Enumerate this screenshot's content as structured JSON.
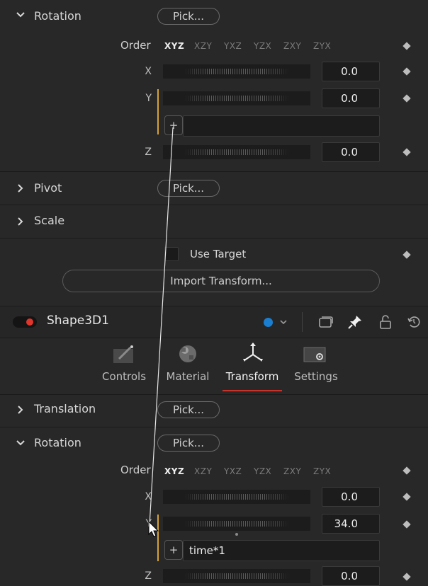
{
  "top_panel": {
    "rotation": {
      "title": "Rotation",
      "pick_label": "Pick...",
      "order_label": "Order",
      "order_options": [
        "XYZ",
        "XZY",
        "YXZ",
        "YZX",
        "ZXY",
        "ZYX"
      ],
      "selected_order": "XYZ",
      "x": {
        "label": "X",
        "value": "0.0"
      },
      "y": {
        "label": "Y",
        "value": "0.0",
        "expr_button": "+",
        "expression": ""
      },
      "z": {
        "label": "Z",
        "value": "0.0"
      }
    },
    "pivot": {
      "title": "Pivot",
      "pick_label": "Pick..."
    },
    "scale": {
      "title": "Scale"
    },
    "use_target": {
      "label": "Use Target",
      "checked": false
    },
    "import_transform_label": "Import Transform..."
  },
  "node_header": {
    "name": "Shape3D1",
    "enabled": true,
    "color_dot": "#1a7fd1",
    "toggle_color": "#e0352b"
  },
  "tabs": [
    {
      "label": "Controls",
      "icon": "controls-icon"
    },
    {
      "label": "Material",
      "icon": "material-icon"
    },
    {
      "label": "Transform",
      "icon": "transform-icon",
      "active": true
    },
    {
      "label": "Settings",
      "icon": "settings-icon"
    }
  ],
  "bottom_panel": {
    "translation": {
      "title": "Translation",
      "pick_label": "Pick..."
    },
    "rotation": {
      "title": "Rotation",
      "pick_label": "Pick...",
      "order_label": "Order",
      "order_options": [
        "XYZ",
        "XZY",
        "YXZ",
        "YZX",
        "ZXY",
        "ZYX"
      ],
      "selected_order": "XYZ",
      "x": {
        "label": "X",
        "value": "0.0"
      },
      "y": {
        "label": "Y",
        "value": "34.0",
        "expr_button": "+",
        "expression": "time*1"
      },
      "z": {
        "label": "Z",
        "value": "0.0"
      }
    }
  },
  "colors": {
    "accent_underline": "#c8322a",
    "expression_bar": "#d5a23d"
  }
}
